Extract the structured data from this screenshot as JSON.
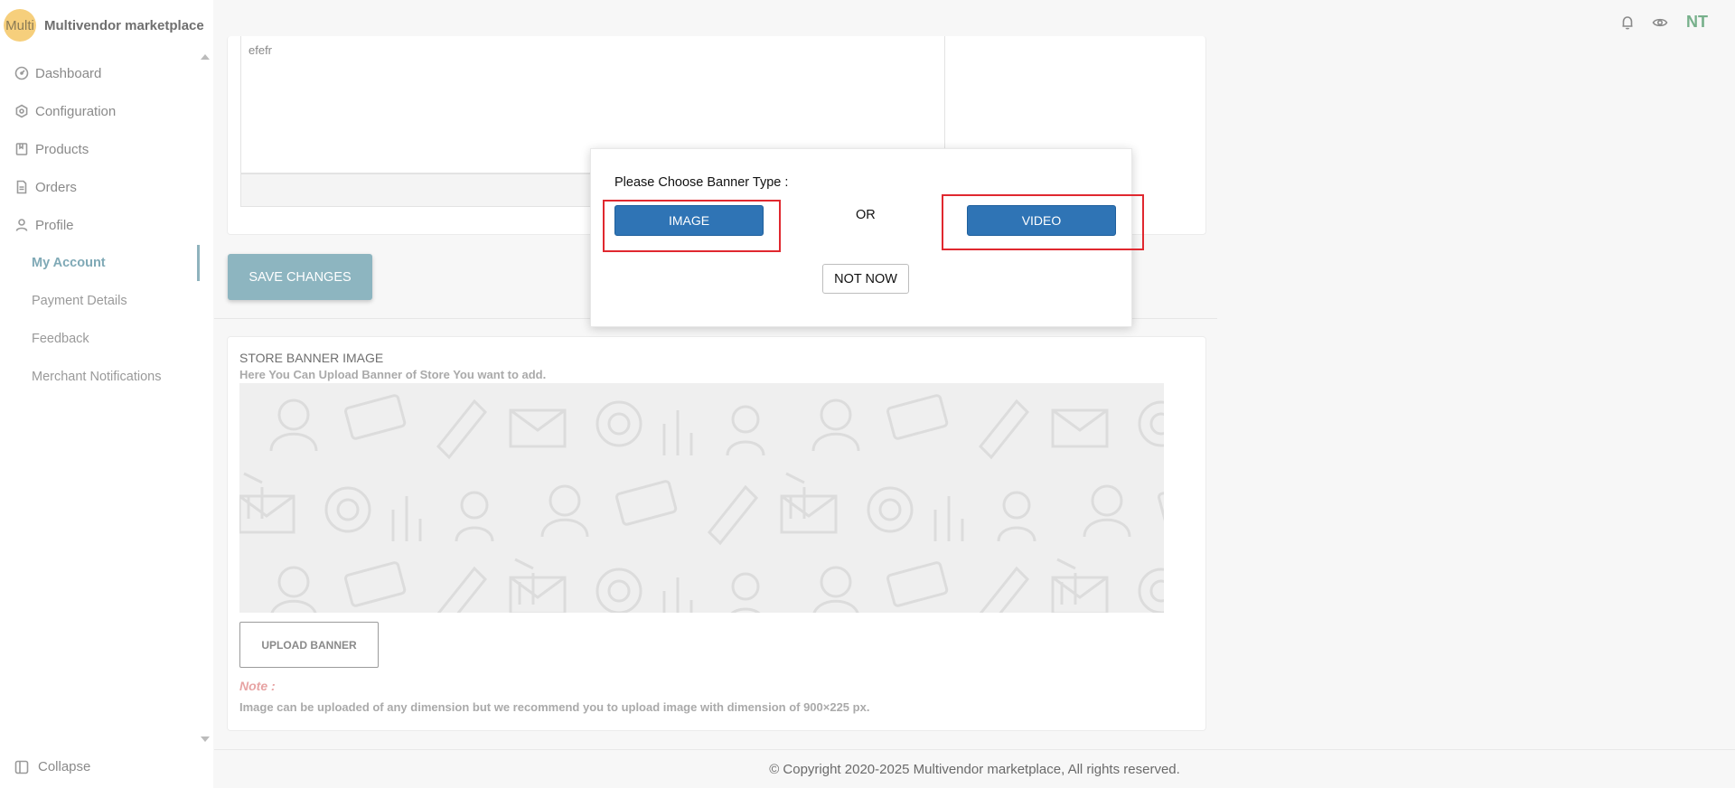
{
  "brand": {
    "logo_text": "Multi",
    "name": "Multivendor marketplace"
  },
  "sidebar": {
    "items": [
      {
        "label": "Dashboard",
        "icon": "gauge-icon"
      },
      {
        "label": "Configuration",
        "icon": "hexagon-settings-icon"
      },
      {
        "label": "Products",
        "icon": "bookmark-box-icon"
      },
      {
        "label": "Orders",
        "icon": "document-icon"
      },
      {
        "label": "Profile",
        "icon": "user-icon"
      }
    ],
    "profile_subitems": [
      {
        "label": "My Account",
        "active": true
      },
      {
        "label": "Payment Details",
        "active": false
      },
      {
        "label": "Feedback",
        "active": false
      },
      {
        "label": "Merchant Notifications",
        "active": false
      }
    ],
    "collapse_label": "Collapse"
  },
  "topbar": {
    "icons": [
      "bell-icon",
      "eye-icon"
    ],
    "user_initials": "NT"
  },
  "form": {
    "textarea_value": "efefr",
    "save_label": "SAVE CHANGES"
  },
  "banner": {
    "title": "STORE BANNER IMAGE",
    "subtitle": "Here You Can Upload Banner of Store You want to add.",
    "upload_label": "UPLOAD BANNER",
    "note_label": "Note :",
    "note_text": "Image can be uploaded of any dimension but we recommend you to upload image with dimension of 900×225 px."
  },
  "footer": {
    "text": "© Copyright 2020-2025 Multivendor marketplace, All rights reserved."
  },
  "modal": {
    "title": "Please Choose Banner Type :",
    "image_label": "IMAGE",
    "or_label": "OR",
    "video_label": "VIDEO",
    "not_now_label": "NOT NOW"
  },
  "colors": {
    "accent": "#8db5c0",
    "primary_button": "#2f74b5",
    "highlight": "#e0282f",
    "brand_logo": "#f6cf7c",
    "initials": "#77b08b"
  }
}
